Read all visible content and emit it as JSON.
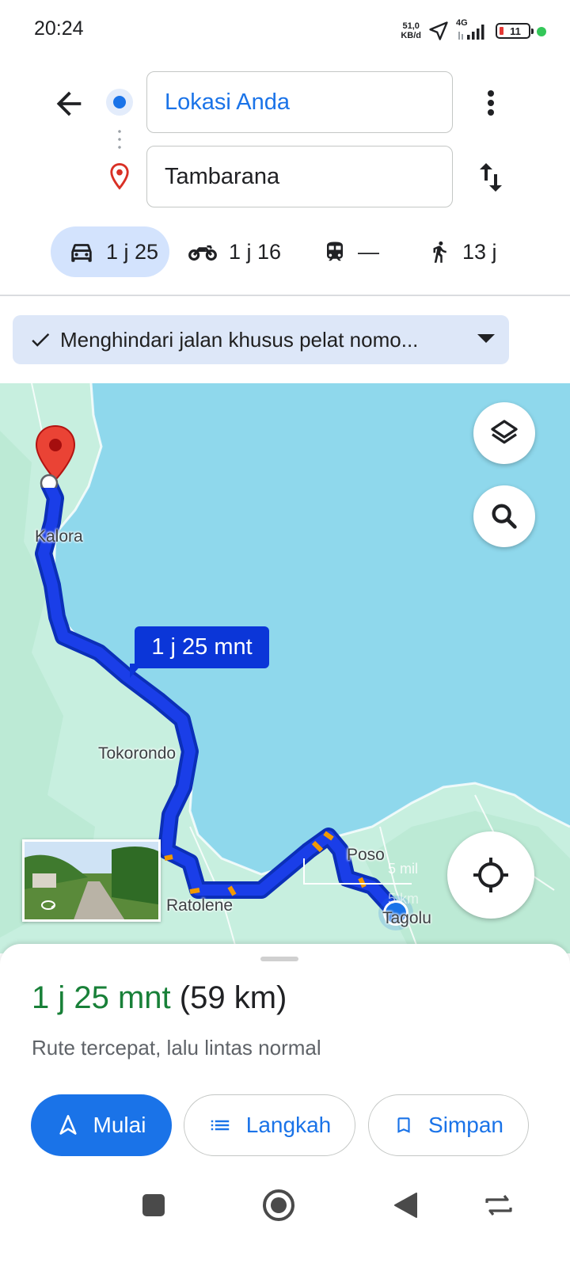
{
  "status_bar": {
    "time": "20:24",
    "speed_value": "51,0",
    "speed_unit": "KB/d",
    "network": "4G",
    "battery": "11"
  },
  "header": {
    "origin": "Lokasi Anda",
    "destination": "Tambarana"
  },
  "modes": {
    "car": "1 j 25",
    "motorcycle": "1 j 16",
    "transit": "—",
    "walk": "13 j"
  },
  "filter_chip": {
    "label": "Menghindari jalan khusus pelat nomo..."
  },
  "map": {
    "duration_bubble": "1 j 25 mnt",
    "places": {
      "kalora": "Kalora",
      "tokorondo": "Tokorondo",
      "ratolene": "Ratolene",
      "poso": "Poso",
      "tagolu": "Tagolu"
    },
    "scale_mi": "5 mil",
    "scale_km": "5 km",
    "colors": {
      "water": "#8fd8ec",
      "land": "#c7efdf",
      "route": "#1a3ee8",
      "traffic": "#f29900"
    }
  },
  "sheet": {
    "duration": "1 j 25 mnt",
    "distance": "(59 km)",
    "description": "Rute tercepat, lalu lintas normal",
    "start_label": "Mulai",
    "steps_label": "Langkah",
    "save_label": "Simpan"
  },
  "accent_color": "#1a73e8"
}
